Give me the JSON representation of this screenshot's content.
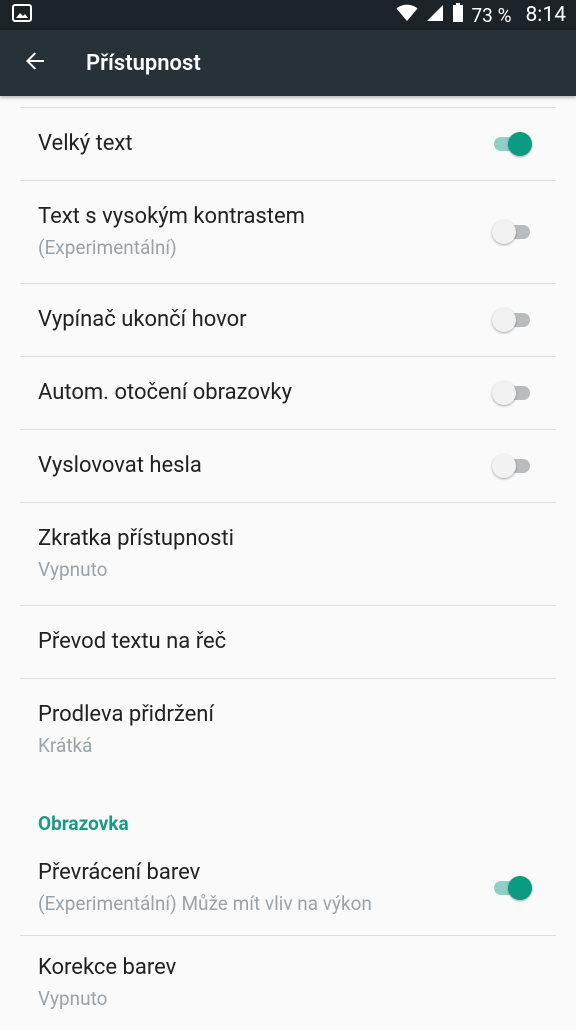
{
  "status_bar": {
    "battery_percent": "73 %",
    "time": "8:14",
    "icons": [
      "image-notification-icon",
      "wifi-icon",
      "cell-signal-icon",
      "battery-icon"
    ]
  },
  "app_bar": {
    "title": "Přístupnost",
    "back_icon": "arrow-left-icon"
  },
  "settings": [
    {
      "title": "Velký text",
      "subtitle": "",
      "toggle": true,
      "state": "on"
    },
    {
      "title": "Text s vysokým kontrastem",
      "subtitle": "(Experimentální)",
      "toggle": true,
      "state": "off"
    },
    {
      "title": "Vypínač ukončí hovor",
      "subtitle": "",
      "toggle": true,
      "state": "off"
    },
    {
      "title": "Autom. otočení obrazovky",
      "subtitle": "",
      "toggle": true,
      "state": "off"
    },
    {
      "title": "Vyslovovat hesla",
      "subtitle": "",
      "toggle": true,
      "state": "off"
    },
    {
      "title": "Zkratka přístupnosti",
      "subtitle": "Vypnuto",
      "toggle": false
    },
    {
      "title": "Převod textu na řeč",
      "subtitle": "",
      "toggle": false
    },
    {
      "title": "Prodleva přidržení",
      "subtitle": "Krátká",
      "toggle": false
    }
  ],
  "display_section": {
    "header": "Obrazovka",
    "items": [
      {
        "title": "Převrácení barev",
        "subtitle": "(Experimentální) Může mít vliv na výkon",
        "toggle": true,
        "state": "on"
      },
      {
        "title": "Korekce barev",
        "subtitle": "Vypnuto",
        "toggle": false
      }
    ]
  },
  "colors": {
    "accent": "#0b9b82",
    "app_bar": "#263238",
    "status_bar": "#1c2328"
  }
}
